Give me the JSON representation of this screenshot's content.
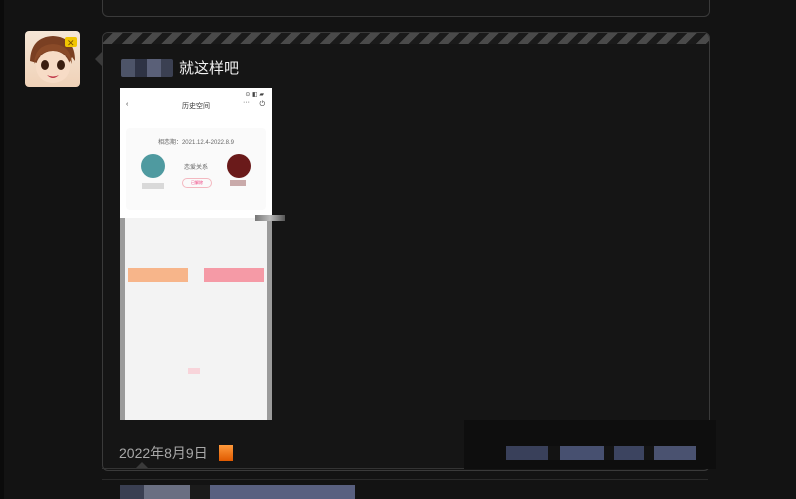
{
  "post": {
    "text": "就这样吧",
    "date": "2022年8月9日"
  },
  "screenshot": {
    "status": "⊙ ◧ ▰",
    "back": "‹",
    "title": "历史空间",
    "more": "···",
    "power": "⏻",
    "period": "相恋期：2021.12.4-2022.8.9",
    "relation": "恋爱关系",
    "pill": "已解除"
  },
  "colors": {
    "background": "#131313",
    "card_border": "#3a3a3a",
    "date_text": "#a8a8a8"
  }
}
